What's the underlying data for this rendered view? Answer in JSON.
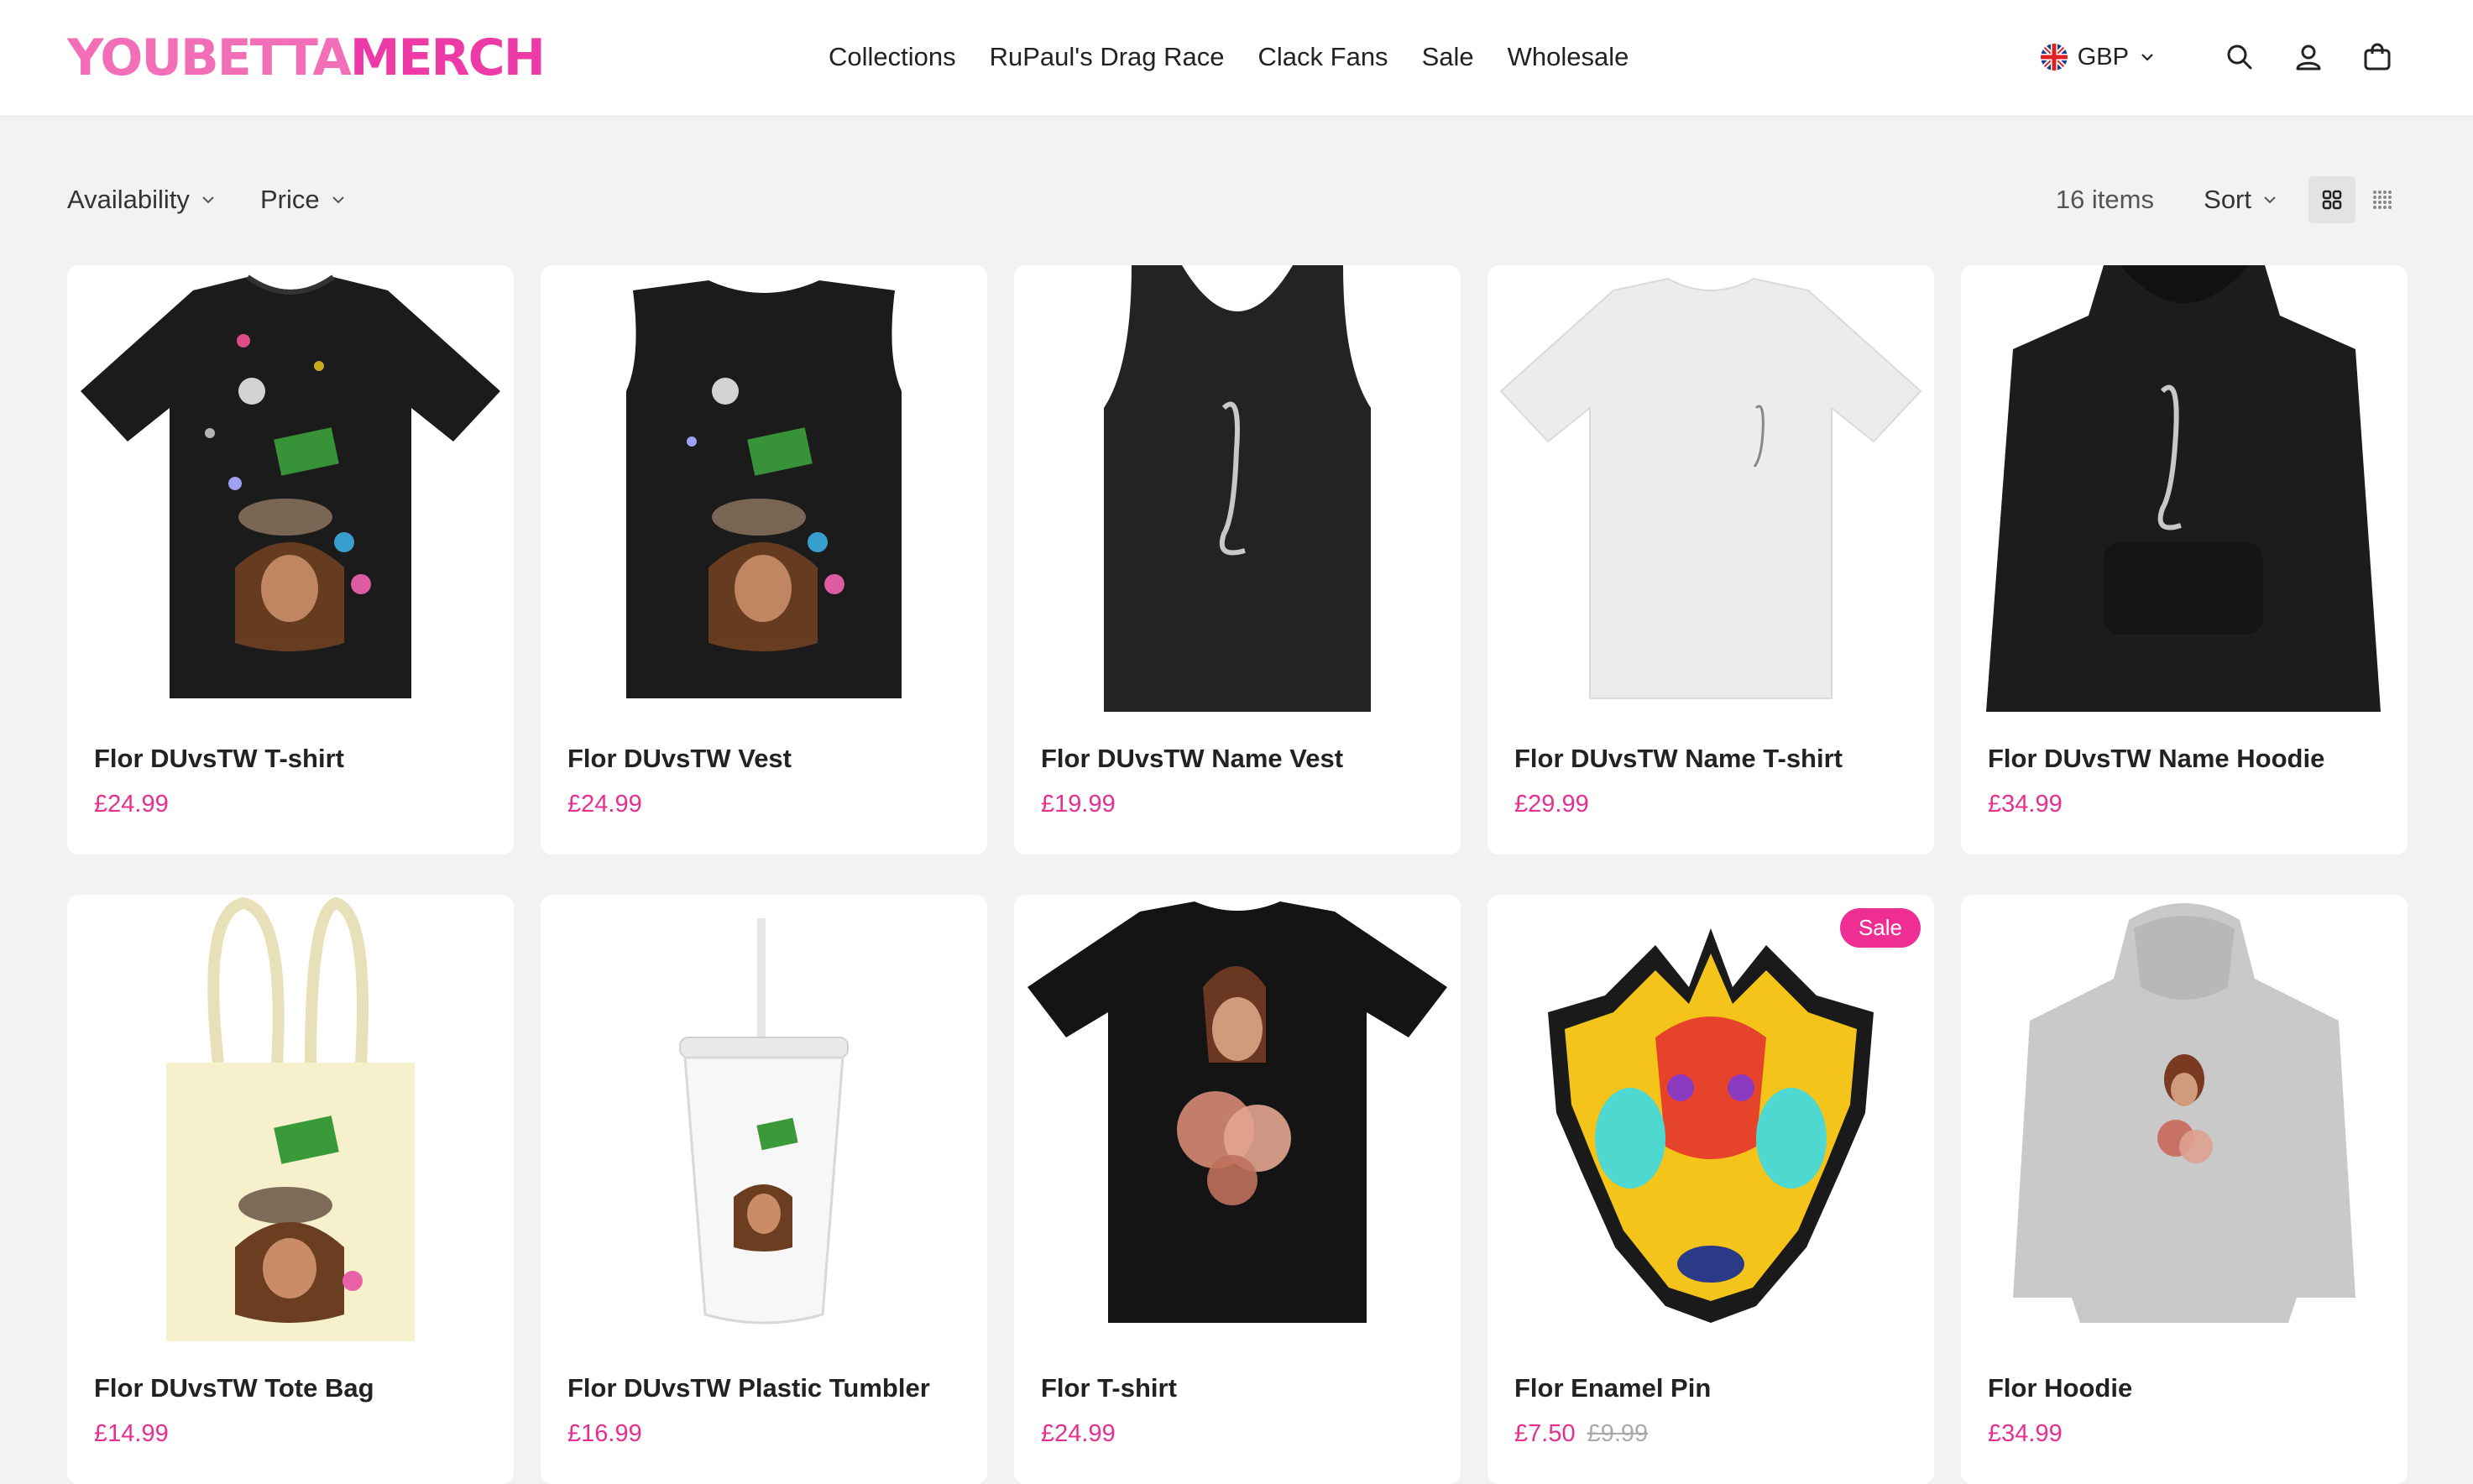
{
  "brand": {
    "logo_part1": "YOUBETTA",
    "logo_part2": "MERCH",
    "accent": "#ee3aa6",
    "price_color": "#e5308f"
  },
  "nav": [
    "Collections",
    "RuPaul's Drag Race",
    "Clack Fans",
    "Sale",
    "Wholesale"
  ],
  "header": {
    "currency": "GBP",
    "icons": [
      "uk-flag-icon",
      "search-icon",
      "account-icon",
      "cart-icon"
    ]
  },
  "toolbar": {
    "availability": "Availability",
    "price": "Price",
    "count": "16 items",
    "sort": "Sort",
    "icons": [
      "grid-large-icon",
      "grid-small-icon"
    ]
  },
  "products": [
    {
      "title": "Flor DUvsTW T-shirt",
      "price": "£24.99"
    },
    {
      "title": "Flor DUvsTW Vest",
      "price": "£24.99"
    },
    {
      "title": "Flor DUvsTW Name Vest",
      "price": "£19.99"
    },
    {
      "title": "Flor DUvsTW Name T-shirt",
      "price": "£29.99"
    },
    {
      "title": "Flor DUvsTW Name Hoodie",
      "price": "£34.99"
    },
    {
      "title": "Flor DUvsTW Tote Bag",
      "price": "£14.99"
    },
    {
      "title": "Flor DUvsTW Plastic Tumbler",
      "price": "£16.99"
    },
    {
      "title": "Flor T-shirt",
      "price": "£24.99"
    },
    {
      "title": "Flor Enamel Pin",
      "price": "£7.50",
      "old_price": "£9.99",
      "badge": "Sale"
    },
    {
      "title": "Flor Hoodie",
      "price": "£34.99"
    }
  ]
}
